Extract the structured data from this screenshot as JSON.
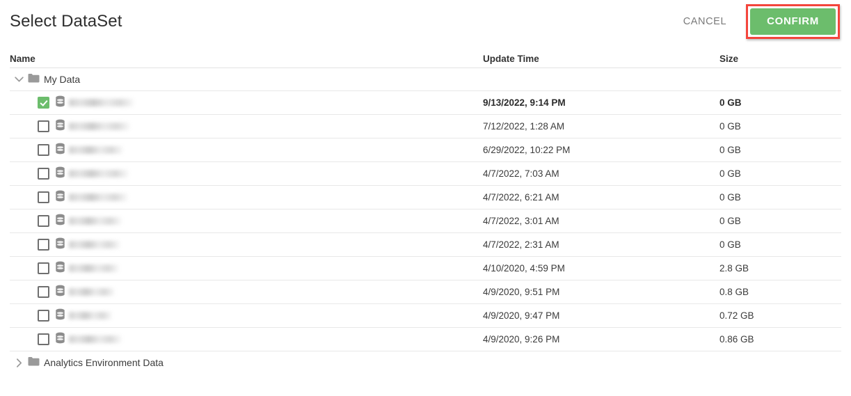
{
  "dialog": {
    "title": "Select DataSet",
    "cancel_label": "CANCEL",
    "confirm_label": "CONFIRM",
    "confirm_color": "#6cbd6c",
    "highlight_color": "#f4453c"
  },
  "columns": {
    "name": "Name",
    "update_time": "Update Time",
    "size": "Size"
  },
  "folders": [
    {
      "label": "My Data",
      "expanded": true,
      "chevron": "chevron-down-icon"
    },
    {
      "label": "Analytics Environment Data",
      "expanded": false,
      "chevron": "chevron-right-icon"
    }
  ],
  "rows": [
    {
      "name": "",
      "name_redacted": true,
      "name_width": 94,
      "update_time": "9/13/2022, 9:14 PM",
      "size": "0 GB",
      "checked": true
    },
    {
      "name": "",
      "name_redacted": true,
      "name_width": 88,
      "update_time": "7/12/2022, 1:28 AM",
      "size": "0 GB",
      "checked": false
    },
    {
      "name": "",
      "name_redacted": true,
      "name_width": 78,
      "update_time": "6/29/2022, 10:22 PM",
      "size": "0 GB",
      "checked": false
    },
    {
      "name": "",
      "name_redacted": true,
      "name_width": 86,
      "update_time": "4/7/2022, 7:03 AM",
      "size": "0 GB",
      "checked": false
    },
    {
      "name": "",
      "name_redacted": true,
      "name_width": 85,
      "update_time": "4/7/2022, 6:21 AM",
      "size": "0 GB",
      "checked": false
    },
    {
      "name": "",
      "name_redacted": true,
      "name_width": 76,
      "update_time": "4/7/2022, 3:01 AM",
      "size": "0 GB",
      "checked": false
    },
    {
      "name": "",
      "name_redacted": true,
      "name_width": 74,
      "update_time": "4/7/2022, 2:31 AM",
      "size": "0 GB",
      "checked": false
    },
    {
      "name": "",
      "name_redacted": true,
      "name_width": 72,
      "update_time": "4/10/2020, 4:59 PM",
      "size": "2.8 GB",
      "checked": false
    },
    {
      "name": "",
      "name_redacted": true,
      "name_width": 66,
      "update_time": "4/9/2020, 9:51 PM",
      "size": "0.8 GB",
      "checked": false
    },
    {
      "name": "",
      "name_redacted": true,
      "name_width": 62,
      "update_time": "4/9/2020, 9:47 PM",
      "size": "0.72 GB",
      "checked": false
    },
    {
      "name": "",
      "name_redacted": true,
      "name_width": 76,
      "update_time": "4/9/2020, 9:26 PM",
      "size": "0.86 GB",
      "checked": false
    }
  ]
}
